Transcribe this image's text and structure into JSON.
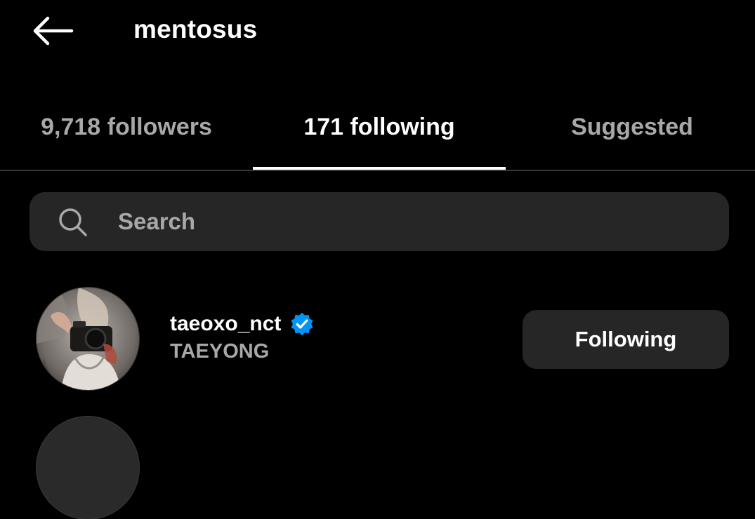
{
  "header": {
    "back_icon": "arrow-left-icon",
    "username": "mentosus"
  },
  "tabs": [
    {
      "label": "9,718 followers",
      "active": false
    },
    {
      "label": "171 following",
      "active": true
    },
    {
      "label": "Suggested",
      "active": false
    }
  ],
  "search": {
    "icon": "search-icon",
    "placeholder": "Search",
    "value": ""
  },
  "users": [
    {
      "handle": "taeoxo_nct",
      "full_name": "TAEYONG",
      "verified": true,
      "button_label": "Following"
    }
  ],
  "colors": {
    "background": "#000000",
    "primary_text": "#ffffff",
    "secondary_text": "#a8a8a8",
    "surface": "#262626",
    "verified_blue": "#0095f6"
  }
}
